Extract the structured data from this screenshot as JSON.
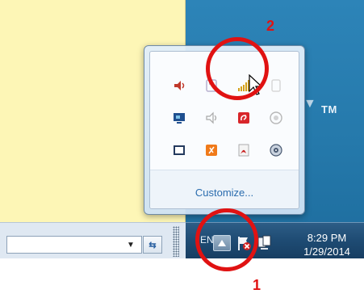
{
  "popup": {
    "customize_label": "Customize...",
    "icons": [
      {
        "name": "volume-icon",
        "color": "#c0392b"
      },
      {
        "name": "faded-app-icon",
        "color": "#8e7fb0"
      },
      {
        "name": "network-signal-icon",
        "color": "#d4a017"
      },
      {
        "name": "faded-white-icon",
        "color": "#d8d8d8"
      },
      {
        "name": "display-adapter-icon",
        "color": "#1f4f8f"
      },
      {
        "name": "faded-volume-icon",
        "color": "#a8a8a8"
      },
      {
        "name": "red-app-icon",
        "color": "#d8262a"
      },
      {
        "name": "faded-globe-icon",
        "color": "#b7b7b7"
      },
      {
        "name": "video-icon",
        "color": "#243a5e"
      },
      {
        "name": "orange-app-icon",
        "color": "#f07a1a"
      },
      {
        "name": "acrobat-icon",
        "color": "#c81f1f"
      },
      {
        "name": "disc-icon",
        "color": "#4a5a72"
      }
    ]
  },
  "taskbar": {
    "language": "EN",
    "time": "8:29 PM",
    "date": "1/29/2014"
  },
  "desktop": {
    "logo_text": "TM"
  },
  "annotations": {
    "step1": "1",
    "step2": "2",
    "color": "#e01212"
  }
}
